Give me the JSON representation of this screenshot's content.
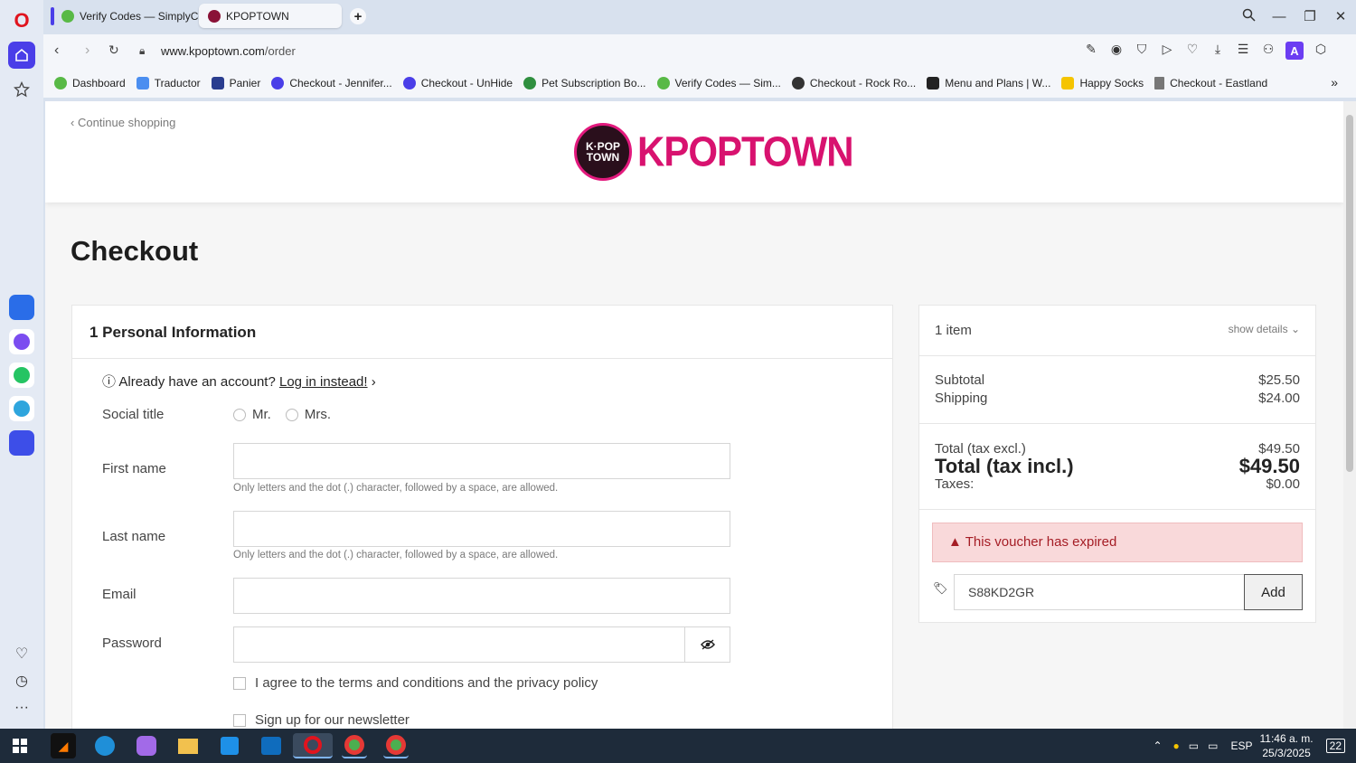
{
  "browser": {
    "tabs": [
      {
        "label": "Verify Codes — SimplyCo"
      },
      {
        "label": "KPOPTOWN"
      }
    ],
    "url_host": "www.kpoptown.com",
    "url_path": "/order",
    "bookmarks": [
      "Dashboard",
      "Traductor",
      "Panier",
      "Checkout - Jennifer...",
      "Checkout - UnHide",
      "Pet Subscription Bo...",
      "Verify Codes — Sim...",
      "Checkout - Rock Ro...",
      "Menu and Plans | W...",
      "Happy Socks",
      "Checkout - Eastland"
    ]
  },
  "header": {
    "continue_label": "Continue shopping",
    "logo_badge_line1": "K·POP",
    "logo_badge_line2": "TOWN",
    "logo_text": "KPOPTOWN"
  },
  "page_title": "Checkout",
  "personal": {
    "section_title": "1 Personal Information",
    "already_text": "Already have an account?",
    "login_link": "Log in instead!",
    "social_title_label": "Social title",
    "mr_label": "Mr.",
    "mrs_label": "Mrs.",
    "first_name_label": "First name",
    "first_name_hint": "Only letters and the dot (.) character, followed by a space, are allowed.",
    "last_name_label": "Last name",
    "last_name_hint": "Only letters and the dot (.) character, followed by a space, are allowed.",
    "email_label": "Email",
    "password_label": "Password",
    "terms_label": "I agree to the terms and conditions and the privacy policy",
    "newsletter_label": "Sign up for our newsletter"
  },
  "summary": {
    "items_label": "1 item",
    "show_details": "show details",
    "subtotal_label": "Subtotal",
    "subtotal_value": "$25.50",
    "shipping_label": "Shipping",
    "shipping_value": "$24.00",
    "total_excl_label": "Total (tax excl.)",
    "total_excl_value": "$49.50",
    "total_incl_label": "Total (tax incl.)",
    "total_incl_value": "$49.50",
    "taxes_label": "Taxes:",
    "taxes_value": "$0.00",
    "alert_text": "This voucher has expired",
    "voucher_code": "S88KD2GR",
    "add_label": "Add"
  },
  "taskbar": {
    "lang": "ESP",
    "time": "11:46 a. m.",
    "date": "25/3/2025",
    "notifications": "22"
  },
  "colors": {
    "brand_pink": "#d8126f",
    "opera_red": "#e0141e",
    "sidebar_accent": "#4a3ee8",
    "alert_bg": "#f9d9da"
  }
}
